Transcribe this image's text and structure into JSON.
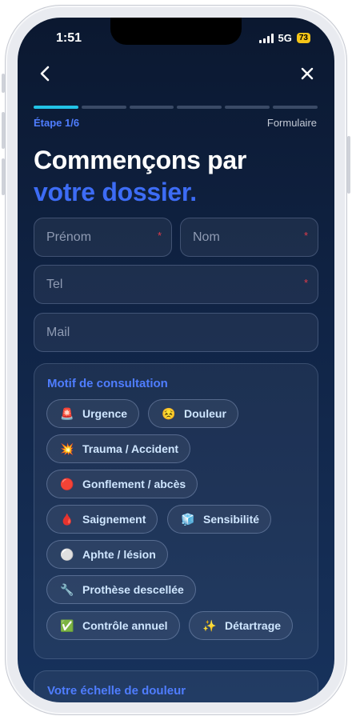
{
  "status_bar": {
    "time": "1:51",
    "network": "5G",
    "battery": "73"
  },
  "nav": {
    "back_icon": "chevron-left-icon",
    "close_icon": "close-icon"
  },
  "progress": {
    "total_steps": 6,
    "current_step": 1
  },
  "step": {
    "label": "Étape 1/6",
    "right_label": "Formulaire"
  },
  "heading": {
    "line1": "Commençons par",
    "line2": "votre dossier."
  },
  "form": {
    "prenom_placeholder": "Prénom",
    "nom_placeholder": "Nom",
    "tel_placeholder": "Tel",
    "mail_placeholder": "Mail",
    "required_mark": "*"
  },
  "motif": {
    "title": "Motif de consultation",
    "chips": [
      {
        "emoji": "🚨",
        "label": "Urgence"
      },
      {
        "emoji": "😣",
        "label": "Douleur"
      },
      {
        "emoji": "💥",
        "label": "Trauma / Accident"
      },
      {
        "emoji": "🔴",
        "label": "Gonflement / abcès"
      },
      {
        "emoji": "🩸",
        "label": "Saignement"
      },
      {
        "emoji": "🧊",
        "label": "Sensibilité"
      },
      {
        "emoji": "⚪",
        "label": "Aphte / lésion"
      },
      {
        "emoji": "🔧",
        "label": "Prothèse descellée"
      },
      {
        "emoji": "✅",
        "label": "Contrôle annuel"
      },
      {
        "emoji": "✨",
        "label": "Détartrage"
      }
    ]
  },
  "pain_scale": {
    "title": "Votre échelle de douleur"
  },
  "colors": {
    "accent": "#4f7dff",
    "progress_active": "#22c3e6",
    "required": "#e03b4a"
  }
}
